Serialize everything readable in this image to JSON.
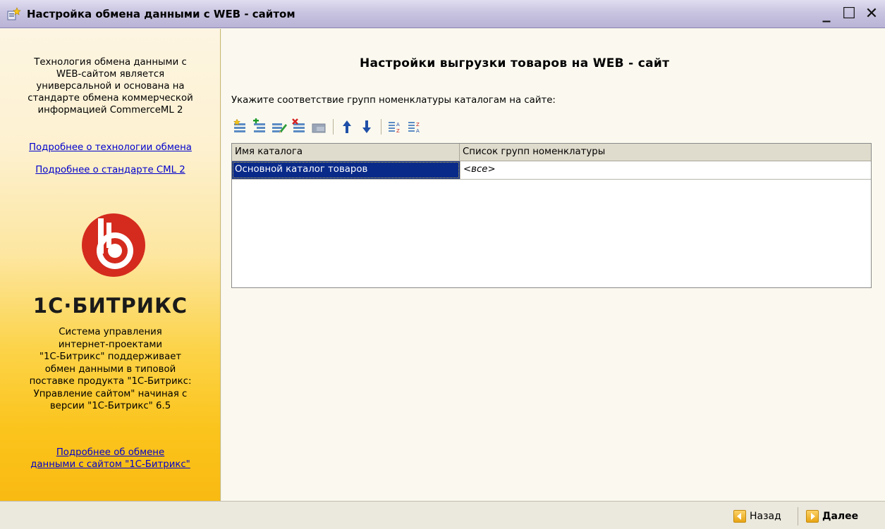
{
  "window": {
    "title": "Настройка обмена данными с WEB - сайтом",
    "icon": "wizard-settings-icon",
    "controls": {
      "minimize": "_",
      "maximize": "☐",
      "close": "✕"
    }
  },
  "sidebar": {
    "intro": [
      "Технология обмена данными с",
      "WEB-сайтом является",
      "универсальной и основана на",
      "стандарте обмена коммерческой",
      "информацией CommerceML 2"
    ],
    "link_exchange_tech": "Подробнее о технологии обмена",
    "link_cml2": "Подробнее о стандарте CML 2",
    "logo_text": "1С·БИТРИКС",
    "description": [
      "Система управления",
      "интернет-проектами",
      "\"1С-Битрикс\" поддерживает",
      "обмен данными в типовой",
      "поставке продукта \"1С-Битрикс:",
      "Управление сайтом\" начиная с",
      "версии \"1С-Битрикс\" 6.5"
    ],
    "link_bitrix_exchange": [
      "Подробнее об обмене",
      "данными с сайтом \"1С-Битрикс\""
    ],
    "colors": {
      "logo_red": "#d42b1e",
      "gradient_bottom": "#f9ba12"
    }
  },
  "main": {
    "heading": "Настройки выгрузки товаров на WEB - сайт",
    "instruction": "Укажите соответствие групп номенклатуры каталогам на сайте:",
    "toolbar": [
      "add-row-icon",
      "add-child-row-icon",
      "edit-row-icon",
      "delete-row-icon",
      "end-edit-icon",
      "move-up-icon",
      "move-down-icon",
      "sort-ascending-icon",
      "sort-descending-icon"
    ],
    "table": {
      "columns": [
        "Имя каталога",
        "Список групп номенклатуры"
      ],
      "rows": [
        {
          "catalog": "Основной каталог товаров",
          "groups": "<все>"
        }
      ]
    }
  },
  "footer": {
    "back_label": "Назад",
    "next_label": "Далее"
  }
}
